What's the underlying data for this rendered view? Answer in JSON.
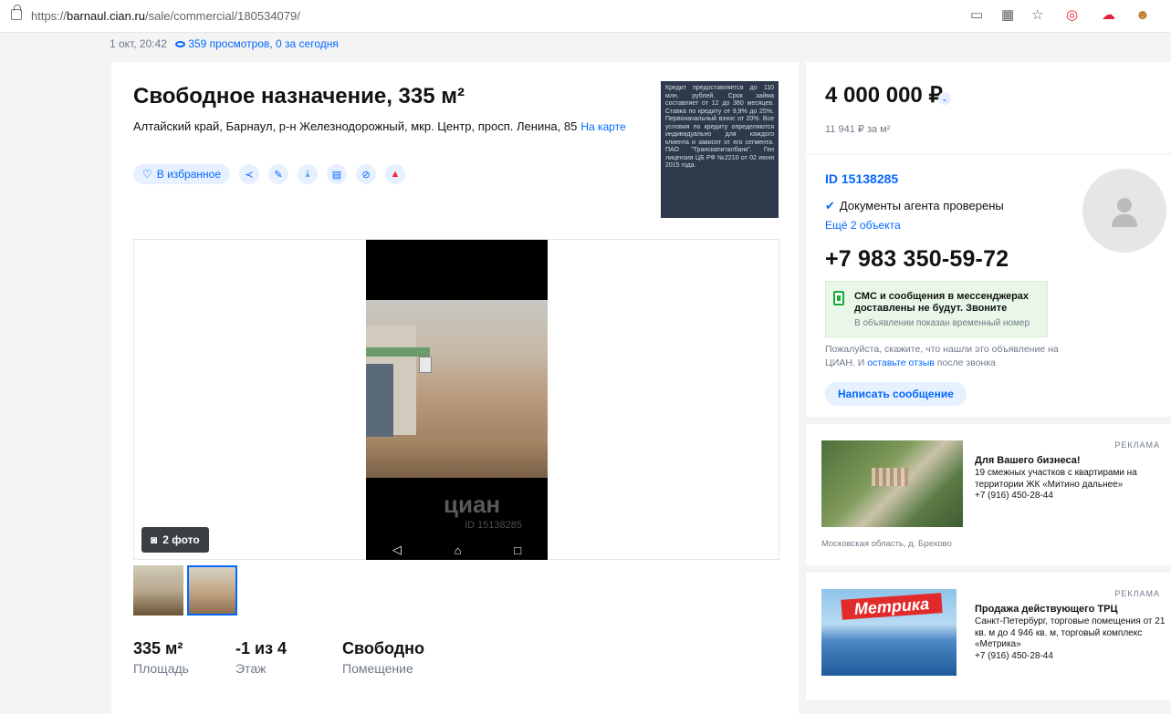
{
  "browser": {
    "url_scheme": "https://",
    "url_host": "barnaul.cian.ru",
    "url_path": "/sale/commercial/180534079/",
    "icons": [
      "tab-icon",
      "grid-icon",
      "favorites-star-icon",
      "extension-red-icon",
      "extension-cloud-icon",
      "extension-avatar-icon"
    ]
  },
  "meta": {
    "date": "1 окт, 20:42",
    "views": "359 просмотров, 0 за сегодня"
  },
  "listing": {
    "title": "Свободное назначение, 335 м²",
    "address": "Алтайский край, Барнаул, р-н Железнодорожный, мкр. Центр, просп. Ленина, 85",
    "map_link": "На карте",
    "favorite_label": "В избранное",
    "action_icons": [
      "share-icon",
      "edit-icon",
      "download-icon",
      "print-icon",
      "hide-icon",
      "complain-icon"
    ],
    "bank_ad": "Кредит предоставляется до 110 млн. рублей. Срок займа составляет от 12 до 360 месяцев. Ставка по кредиту от 9,9% до 25%. Первоначальный взнос от 20%. Все условия по кредиту определяются индивидуально для каждого клиента и зависят от его сегмента. ПАО \"Транскапиталбанк\". Ген лицензия ЦБ РФ №2210 от 02 июня 2015 года.",
    "photo_count": "2 фото",
    "watermark": "циан",
    "watermark_id": "ID 15138285",
    "features": [
      {
        "value": "335 м²",
        "label": "Площадь"
      },
      {
        "value": "-1 из 4",
        "label": "Этаж"
      },
      {
        "value": "Свободно",
        "label": "Помещение"
      }
    ]
  },
  "price": {
    "total": "4 000 000 ₽",
    "per_m2": "11 941 ₽ за м²"
  },
  "agent": {
    "id": "ID 15138285",
    "verified": "Документы агента проверены",
    "more_objects": "Ещё 2 объекта",
    "phone": "+7 983 350-59-72",
    "sms_warning": "СМС и сообщения в мессенджерах доставлены не будут. Звоните",
    "sms_sub": "В объявлении показан временный номер",
    "please_pre": "Пожалуйста, скажите, что нашли это объявление на ЦИАН. И ",
    "please_link": "оставьте отзыв",
    "please_post": " после звонка",
    "write_button": "Написать сообщение"
  },
  "ads": [
    {
      "label": "РЕКЛАМА",
      "title": "Для Вашего бизнеса!",
      "description": "19 смежных участков с квартирами на территории ЖК «Митино дальнее»",
      "phone": "+7 (916) 450-28-44",
      "location": "Московская область, д. Брехово"
    },
    {
      "label": "РЕКЛАМА",
      "title": "Продажа действующего ТРЦ",
      "description": "Санкт-Петербург, торговые помещения от 21 кв. м до 4 946 кв. м, торговый комплекс «Метрика»",
      "phone": "+7 (916) 450-28-44",
      "image_text": "Метрика"
    }
  ],
  "colors": {
    "accent": "#0468ff",
    "danger": "#ff1f34",
    "success": "#1aab3b"
  }
}
